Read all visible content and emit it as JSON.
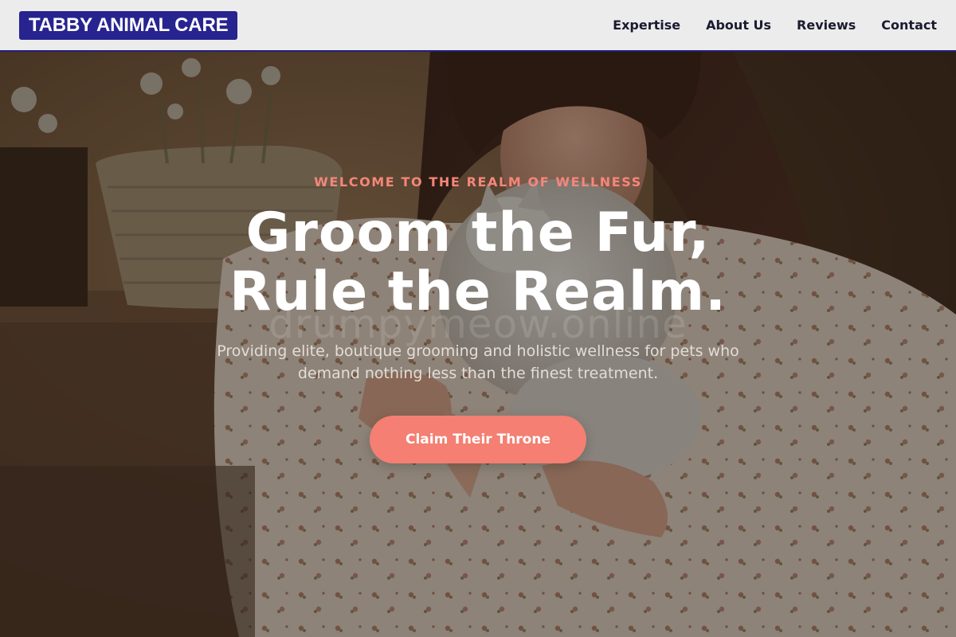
{
  "brand": {
    "logo_text": "TABBY ANIMAL CARE"
  },
  "nav": {
    "items": [
      {
        "label": "Expertise"
      },
      {
        "label": "About Us"
      },
      {
        "label": "Reviews"
      },
      {
        "label": "Contact"
      }
    ]
  },
  "hero": {
    "eyebrow": "WELCOME TO THE REALM OF WELLNESS",
    "headline_line1": "Groom the Fur,",
    "headline_line2": "Rule the Realm.",
    "watermark": "drumpymeow.online",
    "subtext": "Providing elite, boutique grooming and holistic wellness for pets who demand nothing less than the finest treatment.",
    "cta_label": "Claim Their Throne",
    "background_image": "woman-hugging-white-cat-photo"
  },
  "colors": {
    "brand_navy": "#27248f",
    "header_bg": "#ececec",
    "accent_coral": "#f47f72",
    "eyebrow_coral": "#f6867a",
    "nav_text": "#1b1b30"
  }
}
